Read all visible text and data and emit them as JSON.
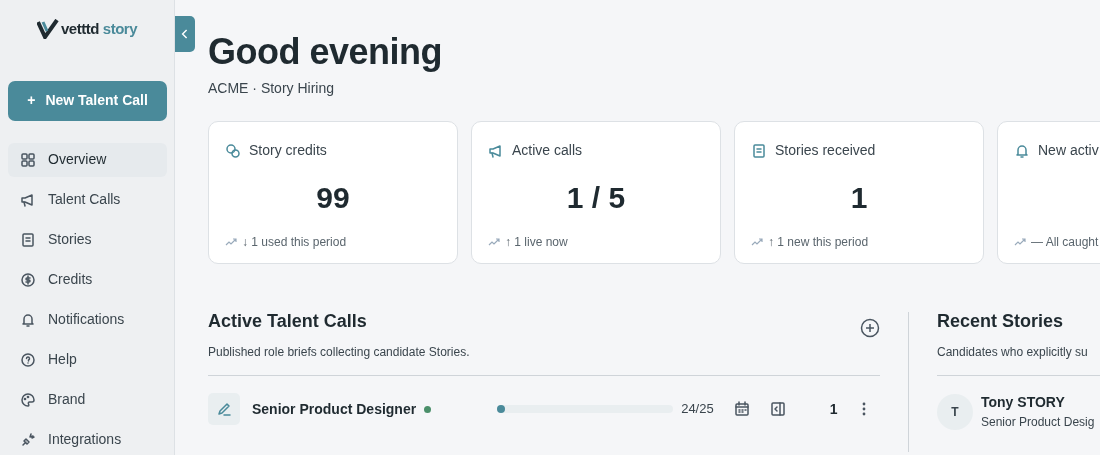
{
  "logo": {
    "part_1": "vetttd",
    "part_2": "story"
  },
  "new_button": {
    "icon": "+",
    "label": "New Talent Call"
  },
  "nav": [
    {
      "label": "Overview",
      "selected": true
    },
    {
      "label": "Talent Calls",
      "selected": false
    },
    {
      "label": "Stories",
      "selected": false
    },
    {
      "label": "Credits",
      "selected": false
    },
    {
      "label": "Notifications",
      "selected": false
    },
    {
      "label": "Help",
      "selected": false
    },
    {
      "label": "Brand",
      "selected": false
    },
    {
      "label": "Integrations",
      "selected": false
    }
  ],
  "header": {
    "title": "Good evening",
    "subtitle": "ACME · Story Hiring"
  },
  "stats": [
    {
      "label": "Story credits",
      "value": "99",
      "trend": "↓ 1 used this period"
    },
    {
      "label": "Active calls",
      "value": "1 / 5",
      "trend": "↑ 1 live now"
    },
    {
      "label": "Stories received",
      "value": "1",
      "trend": "↑ 1 new this period"
    },
    {
      "label": "New activ",
      "trend": "— All caught"
    }
  ],
  "calls": {
    "title": "Active Talent Calls",
    "subtitle": "Published role briefs collecting candidate Stories.",
    "rows": [
      {
        "title": "Senior Product Designer",
        "color": "#4a8f6a",
        "level": 0.03,
        "count": "24/25",
        "stories": "1"
      }
    ]
  },
  "recent": {
    "title": "Recent Stories",
    "subtitle": "Candidates who explicitly su",
    "items": [
      {
        "initial": "T",
        "name": "Tony STORY",
        "role": "Senior Product Desig"
      }
    ]
  }
}
